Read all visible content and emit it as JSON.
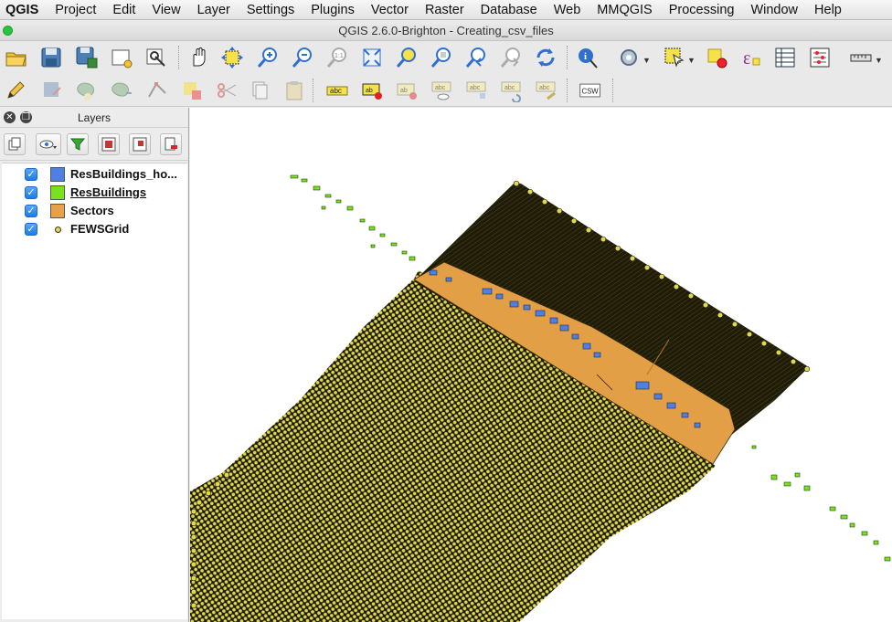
{
  "menubar": {
    "app_name": "QGIS",
    "items": [
      "Project",
      "Edit",
      "View",
      "Layer",
      "Settings",
      "Plugins",
      "Vector",
      "Raster",
      "Database",
      "Web",
      "MMQGIS",
      "Processing",
      "Window",
      "Help"
    ]
  },
  "window": {
    "title": "QGIS 2.6.0-Brighton - Creating_csv_files"
  },
  "toolbar1": {
    "icons": [
      "open-project-icon",
      "save-project-icon",
      "save-as-icon",
      "new-print-composer-icon",
      "composer-manager-icon",
      "pan-icon",
      "pan-to-selection-icon",
      "zoom-in-icon",
      "zoom-out-icon",
      "zoom-actual-size-icon",
      "zoom-full-icon",
      "zoom-to-selection-icon",
      "zoom-to-layer-icon",
      "zoom-last-icon",
      "zoom-next-icon",
      "refresh-icon",
      "identify-icon",
      "run-action-icon",
      "select-features-icon",
      "deselect-icon",
      "field-calculator-icon",
      "attribute-table-icon",
      "statistical-summary-icon",
      "measure-icon"
    ]
  },
  "toolbar2": {
    "icons": [
      "toggle-editing-icon",
      "save-edits-icon",
      "add-feature-icon",
      "move-feature-icon",
      "node-tool-icon",
      "delete-selected-icon",
      "cut-features-icon",
      "copy-features-icon",
      "paste-features-icon",
      "layer-labeling-icon",
      "pin-labels-icon",
      "highlight-pinned-labels-icon",
      "show-hide-labels-icon",
      "move-label-icon",
      "rotate-label-icon",
      "change-label-icon",
      "csw-icon"
    ],
    "csw_label": "CSW"
  },
  "layers_panel": {
    "title": "Layers",
    "layers": [
      {
        "name": "ResBuildings_ho...",
        "checked": true,
        "symbol": "fill",
        "color": "#4f7fe0",
        "active": false
      },
      {
        "name": "ResBuildings",
        "checked": true,
        "symbol": "fill",
        "color": "#7be11f",
        "active": true
      },
      {
        "name": "Sectors",
        "checked": true,
        "symbol": "fill",
        "color": "#e8a14a",
        "active": false
      },
      {
        "name": "FEWSGrid",
        "checked": true,
        "symbol": "point",
        "color": "#e6d84a",
        "active": false
      }
    ]
  },
  "colors": {
    "grid_points": "#e3d84a",
    "grid_outline": "#1a1a1a",
    "sectors": "#e39f45",
    "buildings": "#7be11f",
    "buildings_highlight": "#4f7fe0"
  }
}
